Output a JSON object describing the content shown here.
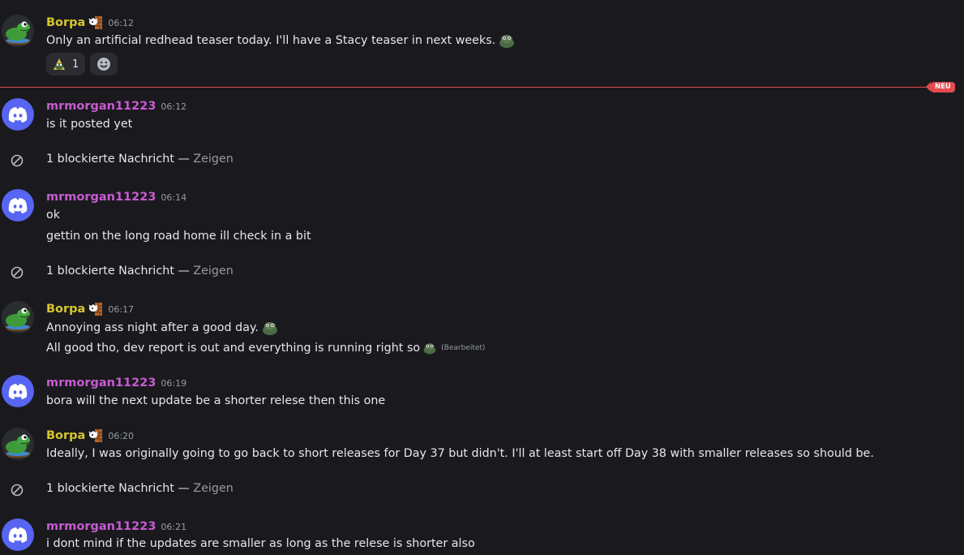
{
  "users": {
    "borpa": "Borpa",
    "morgan": "mrmorgan11223"
  },
  "messages": [
    {
      "time": "06:12",
      "lines": [
        "Only an artificial redhead teaser today. I'll have a Stacy teaser in next weeks."
      ]
    },
    {
      "time": "06:12",
      "lines": [
        "is it posted yet"
      ]
    },
    {
      "time": "06:14",
      "lines": [
        "ok",
        "gettin on the long road home  ill check in a bit"
      ]
    },
    {
      "time": "06:17",
      "lines": [
        "Annoying ass night after a good day.",
        "All good tho, dev report is out and everything is running right so"
      ]
    },
    {
      "time": "06:19",
      "lines": [
        "bora will the next update be a shorter relese then this one"
      ]
    },
    {
      "time": "06:20",
      "lines": [
        "Ideally, I was originally going to go back to short releases for Day 37 but didn't. I'll at least start off Day 38 with smaller releases so should be."
      ]
    },
    {
      "time": "06:21",
      "lines": [
        "i dont mind if the updates are smaller as long as the relese is shorter also"
      ]
    }
  ],
  "reaction": {
    "count": "1"
  },
  "new_divider_label": "NEU",
  "blocked": {
    "text": "1 blockierte Nachricht — ",
    "show": "Zeigen"
  },
  "edited_label": "(Bearbeitet)",
  "colors": {
    "borpa": "#d6c62d",
    "morgan": "#c75bd1",
    "divider": "#e34b4e",
    "discord_blue": "#5865f2"
  },
  "icons": [
    "frog-avatar-icon",
    "discord-avatar-icon",
    "role-badge-icon",
    "blocked-icon",
    "emoji-add-icon",
    "frog-emoji-icon"
  ]
}
